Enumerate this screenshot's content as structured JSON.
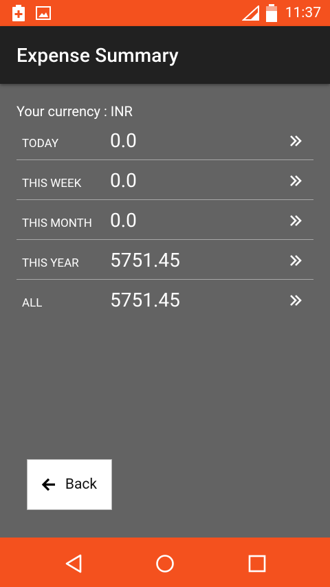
{
  "status_bar": {
    "time": "11:37"
  },
  "app_bar": {
    "title": "Expense Summary"
  },
  "currency": {
    "text": "Your currency : INR"
  },
  "summary": {
    "rows": [
      {
        "label": "TODAY",
        "value": "0.0"
      },
      {
        "label": "THIS WEEK",
        "value": "0.0"
      },
      {
        "label": "THIS MONTH",
        "value": "0.0"
      },
      {
        "label": "THIS YEAR",
        "value": "5751.45"
      },
      {
        "label": "ALL",
        "value": "5751.45"
      }
    ]
  },
  "back_button": {
    "label": "Back"
  },
  "icons": {
    "status_left": [
      "battery-plus-icon",
      "image-icon"
    ],
    "status_right": [
      "signal-icon",
      "battery-icon"
    ],
    "row_action": "double-chevron-right-icon",
    "back": "arrow-left-icon",
    "nav": [
      "back-triangle-icon",
      "home-circle-icon",
      "recents-square-icon"
    ]
  },
  "colors": {
    "status_bar": "#f4511e",
    "app_bar": "#212121",
    "background": "#636363",
    "nav_bar": "#f4511e"
  }
}
